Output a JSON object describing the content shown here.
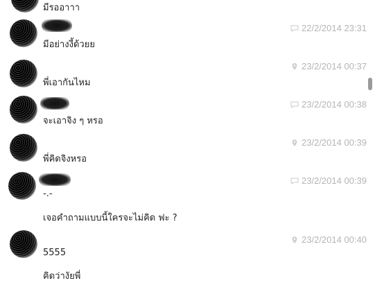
{
  "messages": [
    {
      "text": "มีรออาาา",
      "timestamp": "",
      "icon": "none"
    },
    {
      "text": "มีอย่างงี้ด้วยย",
      "timestamp": "22/2/2014 23:31",
      "icon": "chat-icon"
    },
    {
      "text": "พี่เอากันไหม",
      "timestamp": "23/2/2014 00:37",
      "icon": "location-icon"
    },
    {
      "text": "จะเอาจิง ๆ หรอ",
      "timestamp": "23/2/2014 00:38",
      "icon": "chat-icon"
    },
    {
      "text": "พี่คิดจิงหรอ",
      "timestamp": "23/2/2014 00:39",
      "icon": "location-icon"
    },
    {
      "text": "-.-",
      "timestamp": "23/2/2014 00:39",
      "icon": "chat-icon"
    },
    {
      "text": "เจอคำถามแบบนี้ใครจะไม่คิด ฟะ ?",
      "timestamp": "",
      "icon": "none"
    },
    {
      "text": "5555",
      "timestamp": "23/2/2014 00:40",
      "icon": "location-icon"
    },
    {
      "text": "คิดว่างัยพี่",
      "timestamp": "",
      "icon": "none"
    }
  ],
  "colors": {
    "timestamp": "#b5b5b5",
    "text": "#222222"
  }
}
